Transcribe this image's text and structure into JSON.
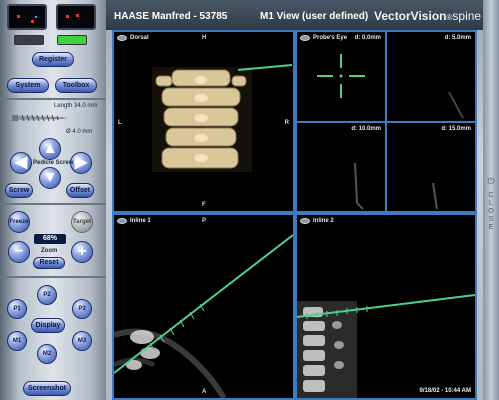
{
  "header": {
    "patient": "HAASE Manfred  - 53785",
    "view_title": "M1 View (user defined)",
    "brand_main": "VectorVision",
    "brand_sub": "spine"
  },
  "left_panel": {
    "register": "Register",
    "system": "System",
    "toolbox": "Toolbox",
    "length": "Length 34.0 mm",
    "diameter": "Ø 4.0 mm",
    "pedicle_screw": "Pedicle Screw",
    "screw": "Screw",
    "offset": "Offset",
    "freeze": "Freeze",
    "target": "Target",
    "zoom_value": "68%",
    "zoom": "Zoom",
    "reset": "Reset",
    "minus": "−",
    "plus": "+",
    "presets": [
      "P1",
      "P2",
      "P3"
    ],
    "display": "Display",
    "monitors": [
      "M1",
      "M2",
      "M3"
    ],
    "screenshot": "Screenshot"
  },
  "right_strip": {
    "close_label": "CLOSE"
  },
  "views": {
    "dorsal": {
      "title": "Dorsal",
      "top": "H",
      "left": "L",
      "right": "R",
      "bottom": "F"
    },
    "probes_eye": {
      "title": "Probe's Eye",
      "d0": "d: 0.0mm",
      "d5": "d: 5.0mm",
      "d10": "d: 10.0mm",
      "d15": "d: 15.0mm"
    },
    "inline1": {
      "title": "Inline 1",
      "top": "P",
      "bottom": "A"
    },
    "inline2": {
      "title": "Inline 2"
    },
    "timestamp": "9/18/02 - 10:44 AM"
  },
  "colors": {
    "probe_green": "#4fd08a",
    "crosshair_green": "#4fd08a",
    "bone": "#d9c79a",
    "viewport_border": "#3d7bc0"
  }
}
